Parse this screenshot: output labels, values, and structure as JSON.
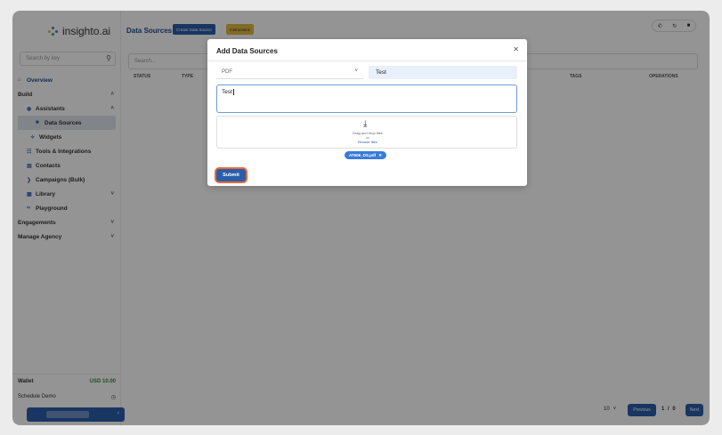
{
  "app": {
    "logo_text": "insighto.ai"
  },
  "sidebar": {
    "search_placeholder": "Search by key",
    "items": [
      {
        "label": "Overview",
        "icon": "home-icon"
      },
      {
        "label": "Build"
      },
      {
        "label": "Assistants",
        "icon": "robot-icon"
      },
      {
        "label": "Data Sources",
        "icon": "document-icon"
      },
      {
        "label": "Widgets",
        "icon": "widget-icon"
      },
      {
        "label": "Tools & Integrations",
        "icon": "tools-icon"
      },
      {
        "label": "Contacts",
        "icon": "contacts-icon"
      },
      {
        "label": "Campaigns (Bulk)",
        "icon": "campaign-icon"
      },
      {
        "label": "Library",
        "icon": "library-icon"
      },
      {
        "label": "Playground",
        "icon": "playground-icon"
      },
      {
        "label": "Engagements"
      },
      {
        "label": "Manage Agency"
      }
    ],
    "wallet_label": "Wallet",
    "wallet_amount": "USD 10.00",
    "schedule_label": "Schedule Demo"
  },
  "header": {
    "title": "Data Sources",
    "create_label": "Create Data Source",
    "instructions_label": "Instructions"
  },
  "main": {
    "search_placeholder": "Search...",
    "columns": [
      "STATUS",
      "TYPE",
      "TAGS",
      "OPERATIONS"
    ],
    "pager": {
      "page_size": "10",
      "previous_label": "Previous",
      "page_info": "1 / 0",
      "next_label": "Next"
    }
  },
  "modal": {
    "title": "Add Data Sources",
    "type_value": "PDF",
    "name_value": "Test",
    "description_value": "Test",
    "drop_text": "Drag and drop files",
    "drop_or": "or",
    "browse_label": "Browse files",
    "file_name": "AT506_DS.pdf",
    "submit_label": "Submit"
  },
  "colors": {
    "primary": "#2a5ea8",
    "accent_yellow": "#e0b940",
    "wallet_green": "#2e8b3d",
    "focus_ring": "#e86a3a"
  }
}
